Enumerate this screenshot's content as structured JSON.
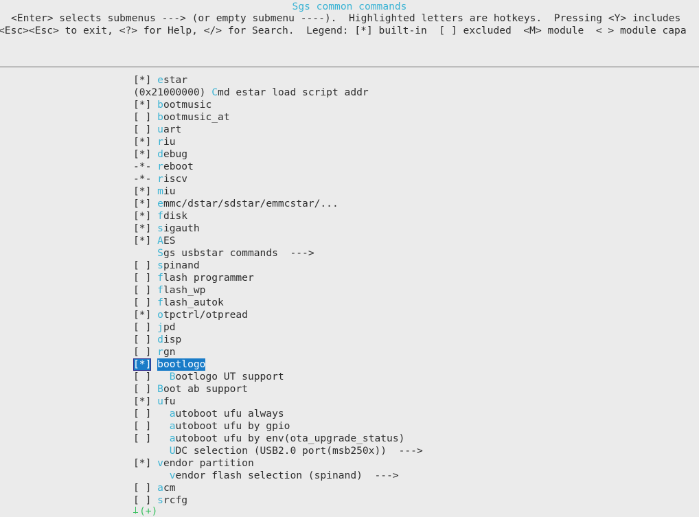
{
  "window": {
    "title": "Sgs common commands",
    "help_line1": "<Enter> selects submenus ---> (or empty submenu ----).  Highlighted letters are hotkeys.  Pressing <Y> includes",
    "help_line2": "<Esc><Esc> to exit, <?> for Help, </> for Search.  Legend: [*] built-in  [ ] excluded  <M> module  < > module capa"
  },
  "colors": {
    "hotkey": "#3ab3d4",
    "selection": "#1a7cc8",
    "background": "#ebebeb",
    "text": "#2e2e2e",
    "more_indicator": "#3ac060"
  },
  "menu": {
    "items": [
      {
        "state": "[*]",
        "indent": " ",
        "hot": "e",
        "rest": "star"
      },
      {
        "state": "(0x21000000)",
        "indent": " ",
        "hot": "C",
        "rest": "md estar load script addr"
      },
      {
        "state": "[*]",
        "indent": " ",
        "hot": "b",
        "rest": "ootmusic"
      },
      {
        "state": "[ ]",
        "indent": " ",
        "hot": "b",
        "rest": "ootmusic_at"
      },
      {
        "state": "[ ]",
        "indent": " ",
        "hot": "u",
        "rest": "art"
      },
      {
        "state": "[*]",
        "indent": " ",
        "hot": "r",
        "rest": "iu"
      },
      {
        "state": "[*]",
        "indent": " ",
        "hot": "d",
        "rest": "ebug"
      },
      {
        "state": "-*-",
        "indent": " ",
        "hot": "r",
        "rest": "eboot"
      },
      {
        "state": "-*-",
        "indent": " ",
        "hot": "r",
        "rest": "iscv"
      },
      {
        "state": "[*]",
        "indent": " ",
        "hot": "m",
        "rest": "iu"
      },
      {
        "state": "[*]",
        "indent": " ",
        "hot": "e",
        "rest": "mmc/dstar/sdstar/emmcstar/..."
      },
      {
        "state": "[*]",
        "indent": " ",
        "hot": "f",
        "rest": "disk"
      },
      {
        "state": "[*]",
        "indent": " ",
        "hot": "s",
        "rest": "igauth"
      },
      {
        "state": "[*]",
        "indent": " ",
        "hot": "A",
        "rest": "ES"
      },
      {
        "state": "   ",
        "indent": " ",
        "hot": "S",
        "rest": "gs usbstar commands  --->"
      },
      {
        "state": "[ ]",
        "indent": " ",
        "hot": "s",
        "rest": "pinand"
      },
      {
        "state": "[ ]",
        "indent": " ",
        "hot": "f",
        "rest": "lash programmer"
      },
      {
        "state": "[ ]",
        "indent": " ",
        "hot": "f",
        "rest": "lash_wp"
      },
      {
        "state": "[ ]",
        "indent": " ",
        "hot": "f",
        "rest": "lash_autok"
      },
      {
        "state": "[*]",
        "indent": " ",
        "hot": "o",
        "rest": "tpctrl/otpread"
      },
      {
        "state": "[ ]",
        "indent": " ",
        "hot": "j",
        "rest": "pd"
      },
      {
        "state": "[ ]",
        "indent": " ",
        "hot": "d",
        "rest": "isp"
      },
      {
        "state": "[ ]",
        "indent": " ",
        "hot": "r",
        "rest": "gn"
      },
      {
        "state": "[*]",
        "indent": " ",
        "hot": "b",
        "rest": "ootlogo",
        "selected": true
      },
      {
        "state": "[ ]",
        "indent": "   ",
        "hot": "B",
        "rest": "ootlogo UT support"
      },
      {
        "state": "[ ]",
        "indent": " ",
        "hot": "B",
        "rest": "oot ab support"
      },
      {
        "state": "[*]",
        "indent": " ",
        "hot": "u",
        "rest": "fu"
      },
      {
        "state": "[ ]",
        "indent": "   ",
        "hot": "a",
        "rest": "utoboot ufu always"
      },
      {
        "state": "[ ]",
        "indent": "   ",
        "hot": "a",
        "rest": "utoboot ufu by gpio"
      },
      {
        "state": "[ ]",
        "indent": "   ",
        "hot": "a",
        "rest": "utoboot ufu by env(ota_upgrade_status)"
      },
      {
        "state": "   ",
        "indent": "   ",
        "hot": "U",
        "rest": "DC selection (USB2.0 port(msb250x))  --->"
      },
      {
        "state": "[*]",
        "indent": " ",
        "hot": "v",
        "rest": "endor partition"
      },
      {
        "state": "   ",
        "indent": "   ",
        "hot": "v",
        "rest": "endor flash selection (spinand)  --->"
      },
      {
        "state": "[ ]",
        "indent": " ",
        "hot": "a",
        "rest": "cm"
      },
      {
        "state": "[ ]",
        "indent": " ",
        "hot": "s",
        "rest": "rcfg"
      }
    ],
    "more_indicator": "(+)"
  }
}
